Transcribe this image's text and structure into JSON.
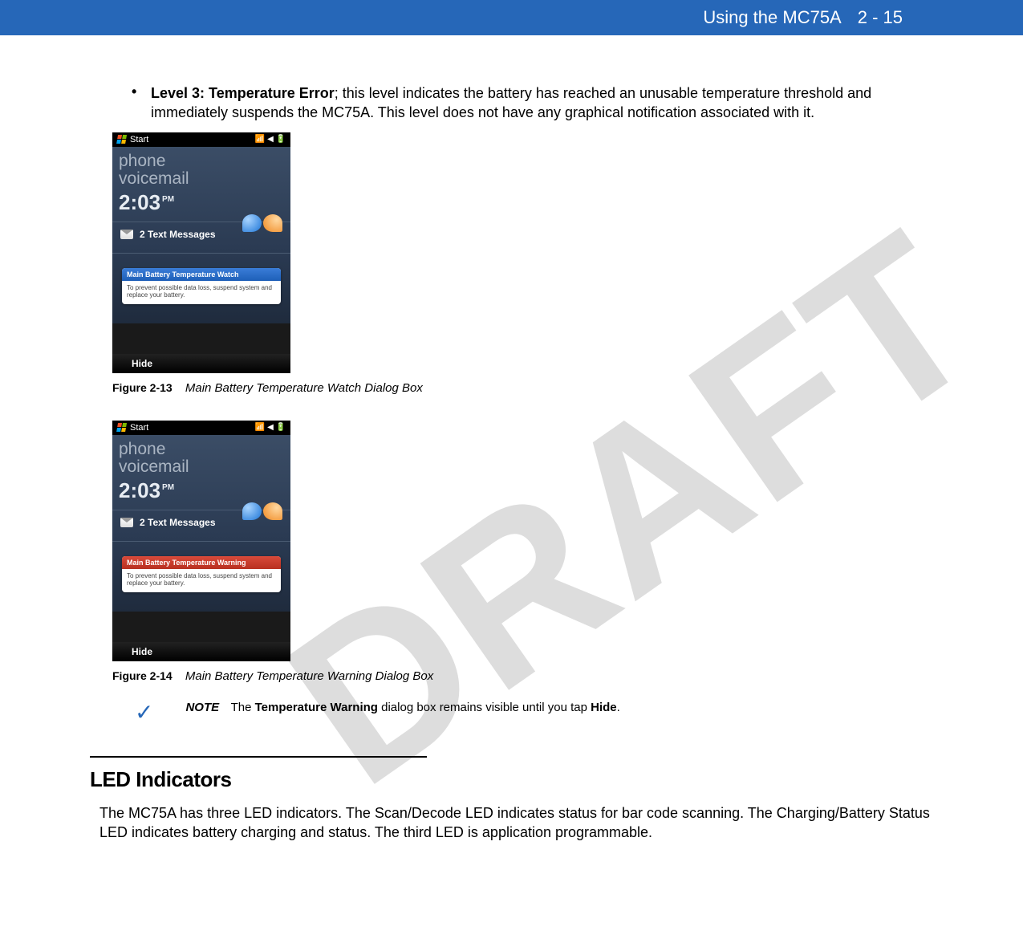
{
  "header": {
    "title": "Using the MC75A",
    "pagenum": "2 - 15"
  },
  "watermark": "DRAFT",
  "bullet": {
    "marker": "•",
    "bold": "Level 3: Temperature Error",
    "rest": "; this level indicates the battery has reached an unusable temperature threshold and immediately suspends the MC75A. This level does not have any graphical notification associated with it."
  },
  "phone": {
    "start": "Start",
    "phone": "phone",
    "voicemail": "voicemail",
    "time": "2:03",
    "ampm": "PM",
    "msgcount": "2 Text Messages",
    "hide": "Hide",
    "alert_body": "To prevent possible data loss, suspend system and replace your battery."
  },
  "fig1": {
    "alert_title": "Main Battery Temperature Watch",
    "label": "Figure 2-13",
    "caption": "Main Battery Temperature Watch Dialog Box"
  },
  "fig2": {
    "alert_title": "Main Battery Temperature Warning",
    "label": "Figure 2-14",
    "caption": "Main Battery Temperature Warning Dialog Box"
  },
  "note": {
    "label": "NOTE",
    "pre": "The ",
    "bold1": "Temperature Warning",
    "mid": " dialog box remains visible until you tap ",
    "bold2": "Hide",
    "post": "."
  },
  "section": {
    "heading": "LED Indicators",
    "para": "The MC75A has three LED indicators. The Scan/Decode LED indicates status for bar code scanning. The Charging/Battery Status LED indicates battery charging and status. The third LED is application programmable."
  }
}
